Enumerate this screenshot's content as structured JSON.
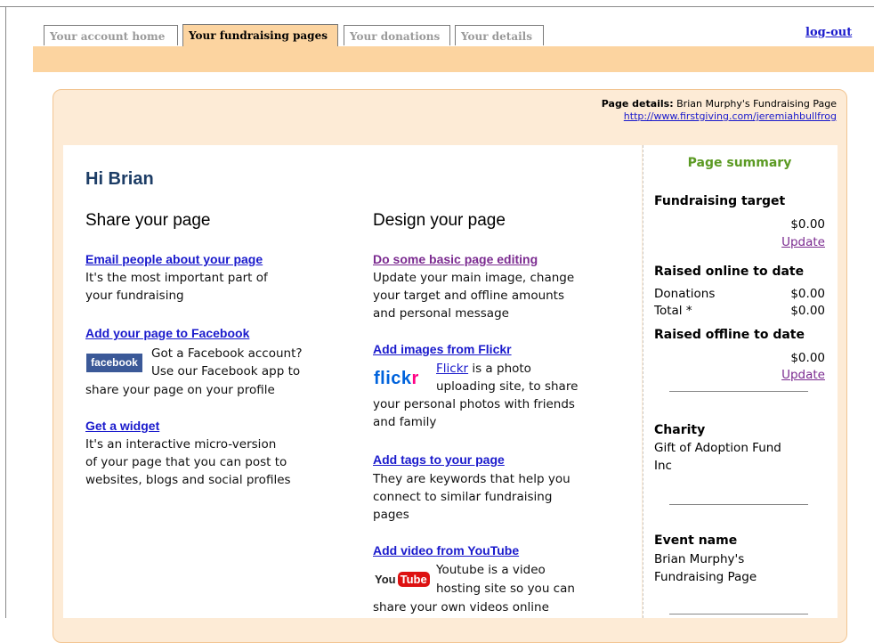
{
  "tabs": [
    "Your account home",
    "Your fundraising pages",
    "Your donations",
    "Your details"
  ],
  "logout_label": "log-out",
  "page_details": {
    "label": "Page details:",
    "name": "Brian Murphy's Fundraising Page",
    "url": "http://www.firstgiving.com/jeremiahbullfrog"
  },
  "greeting": "Hi Brian",
  "share": {
    "heading": "Share your page",
    "email_link": "Email people about your page",
    "email_text": [
      "It's the most important part of",
      "your fundraising"
    ],
    "facebook_link": "Add your page to Facebook",
    "facebook_logo": "facebook",
    "facebook_text": [
      "Got a Facebook account?",
      "Use our Facebook app to",
      "share your page on your profile"
    ],
    "widget_link": "Get a widget",
    "widget_text": [
      "It's an interactive micro-version",
      "of your page that you can post to",
      "websites, blogs and social profiles"
    ]
  },
  "design": {
    "heading": "Design your page",
    "basic_link": "Do some basic page editing",
    "basic_text": [
      "Update your main image, change",
      "your target and offline amounts",
      "and personal message"
    ],
    "flickr_link": "Add images from Flickr",
    "flickr_logo_a": "flick",
    "flickr_logo_b": "r",
    "flickr_word": "Flickr",
    "flickr_text": [
      " is a photo",
      "uploading site, to share",
      "your personal photos with friends",
      "and family"
    ],
    "tags_link": "Add tags to your page",
    "tags_text": [
      "They are keywords that help you",
      "connect to similar fundraising",
      "pages"
    ],
    "youtube_link": "Add video from YouTube",
    "youtube_logo_you": "You",
    "youtube_logo_tube": "Tube",
    "youtube_text": [
      "Youtube is a video",
      "hosting site so you can",
      "share your own videos online"
    ]
  },
  "summary": {
    "title": "Page summary",
    "target_heading": "Fundraising target",
    "target_value": "$0.00",
    "target_update": "Update",
    "online_heading": "Raised online to date",
    "donations_label": "Donations",
    "donations_value": "$0.00",
    "total_label": "Total *",
    "total_value": "$0.00",
    "offline_heading": "Raised offline to date",
    "offline_value": "$0.00",
    "offline_update": "Update",
    "charity_heading": "Charity",
    "charity_name": [
      "Gift of Adoption Fund",
      "Inc"
    ],
    "event_heading": "Event name",
    "event_name": [
      "Brian Murphy's",
      "Fundraising Page"
    ]
  }
}
